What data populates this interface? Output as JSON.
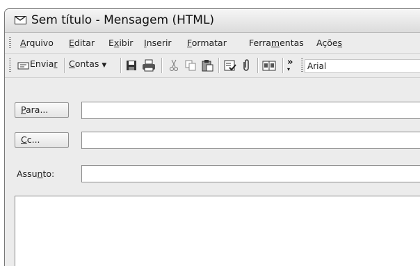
{
  "window": {
    "title": "Sem título - Mensagem (HTML)"
  },
  "menubar": {
    "items": [
      {
        "label": "Arquivo",
        "key": "A"
      },
      {
        "label": "Editar",
        "key": "E"
      },
      {
        "label": "Exibir",
        "key": "x"
      },
      {
        "label": "Inserir",
        "key": "I"
      },
      {
        "label": "Formatar",
        "key": "F"
      },
      {
        "label": "Ferramentas",
        "key": "m"
      },
      {
        "label": "Ações",
        "key": "s"
      }
    ]
  },
  "toolbar": {
    "send_label": "Enviar",
    "accounts_label": "Contas",
    "font_name": "Arial",
    "icons": [
      "send-icon",
      "save-icon",
      "print-icon",
      "cut-icon",
      "copy-icon",
      "paste-icon",
      "check-names-icon",
      "attach-icon",
      "address-book-icon",
      "overflow-chevron-icon"
    ]
  },
  "header": {
    "to_label": "Para...",
    "cc_label": "Cc...",
    "subject_label": "Assunto:",
    "to_value": "",
    "cc_value": "",
    "subject_value": ""
  },
  "body": {
    "text": ""
  }
}
